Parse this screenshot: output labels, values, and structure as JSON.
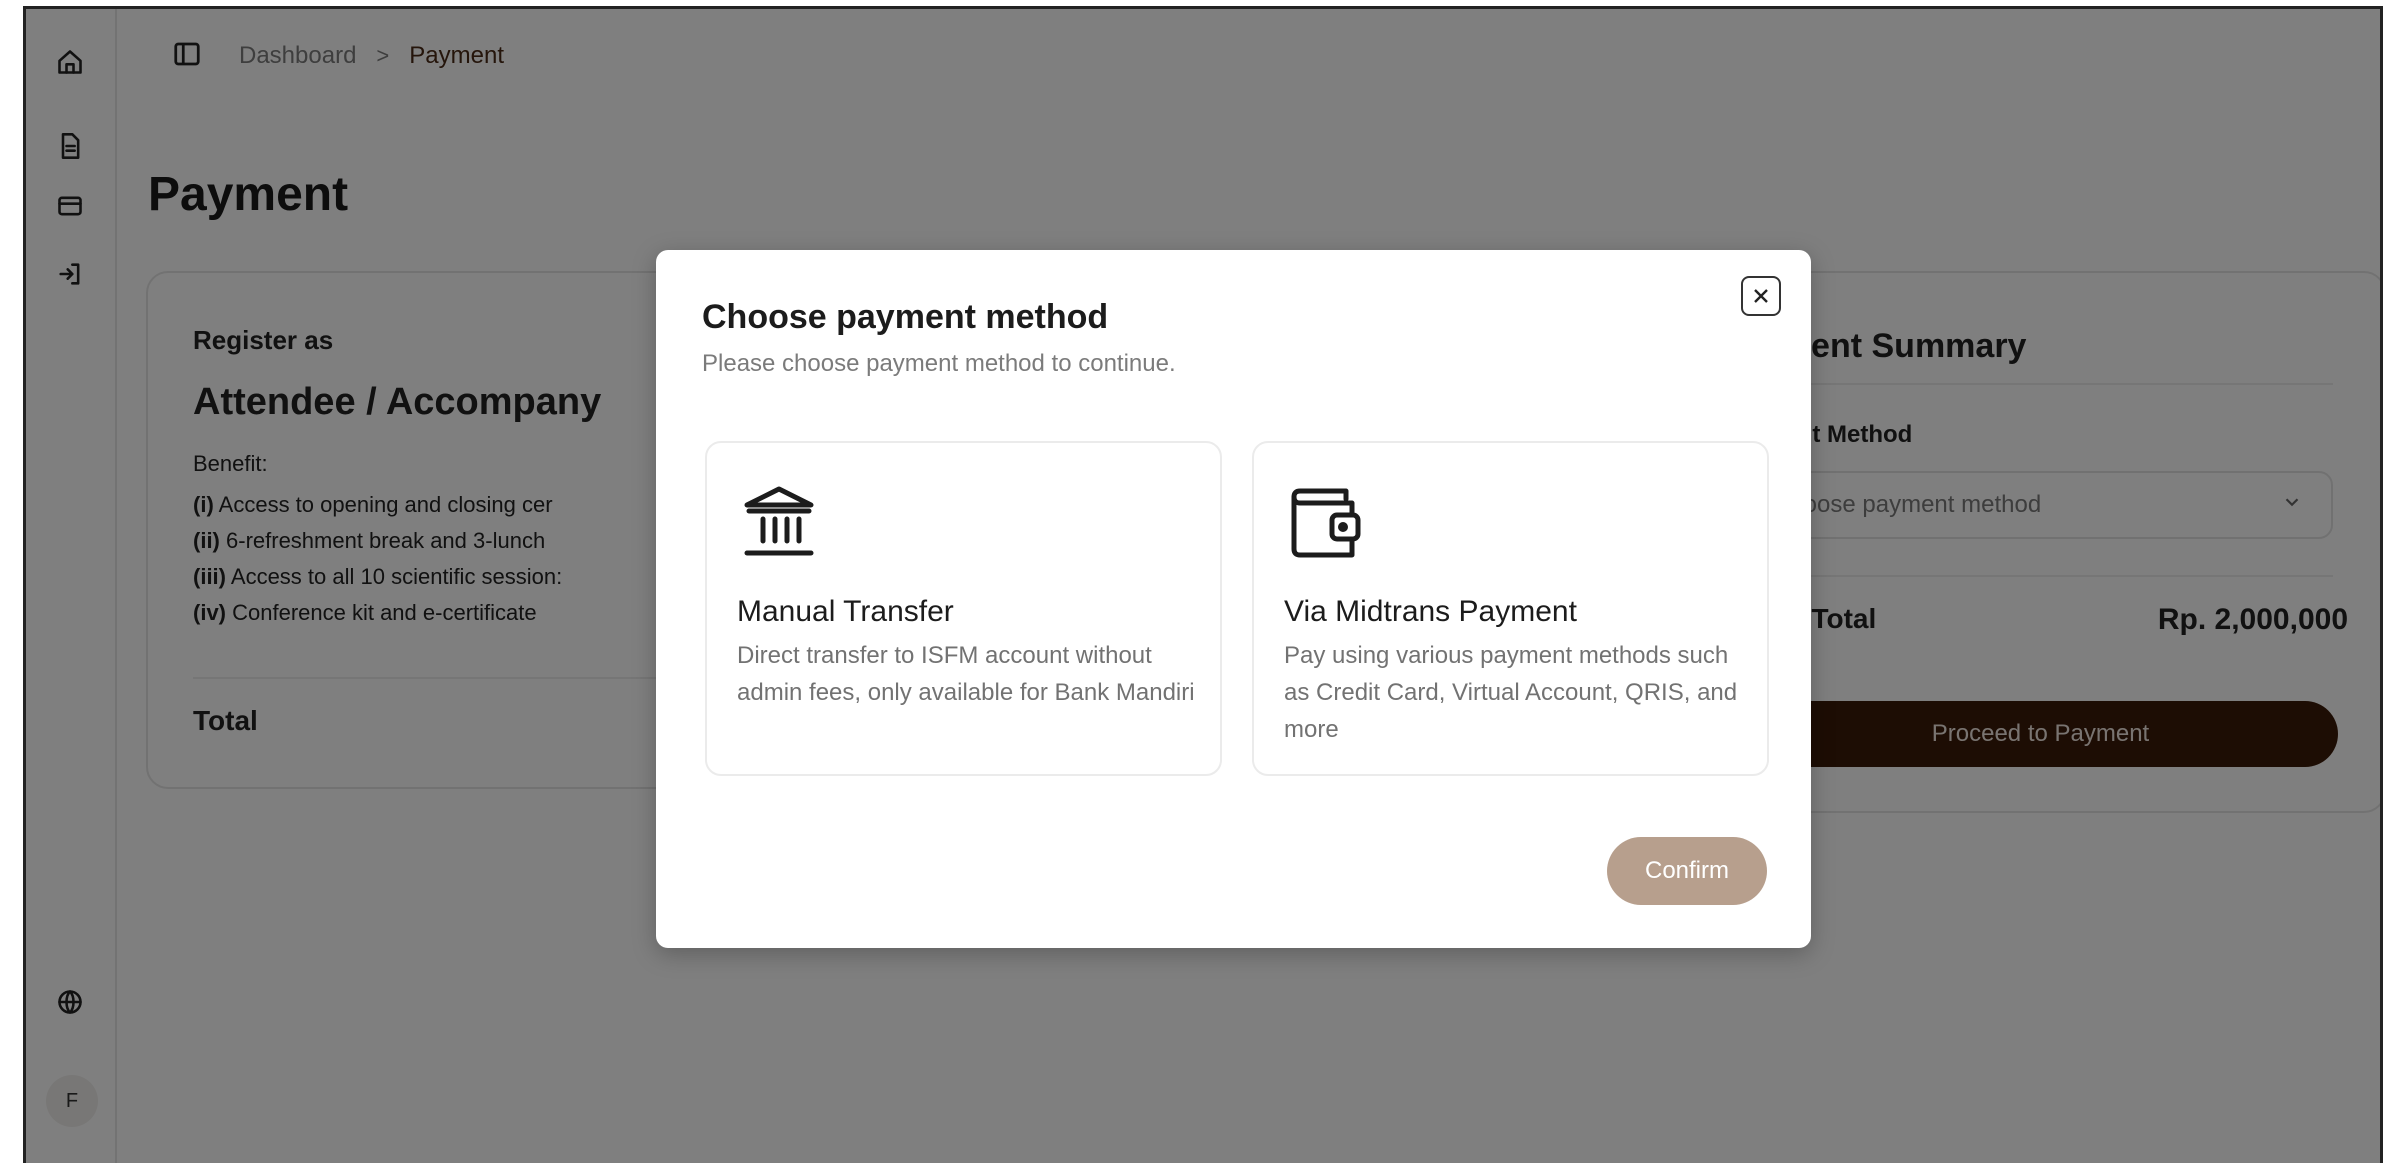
{
  "breadcrumb": {
    "items": [
      "Dashboard"
    ],
    "separator": ">",
    "current": "Payment"
  },
  "page": {
    "title": "Payment"
  },
  "sidebar": {
    "icons": [
      "home-icon",
      "document-icon",
      "credit-card-icon",
      "logout-icon",
      "globe-icon"
    ],
    "avatar_initial": "F"
  },
  "registration": {
    "label": "Register as",
    "type": "Attendee / Accompany",
    "benefit_label": "Benefit:",
    "benefits": [
      {
        "num": "(i)",
        "text": " Access to opening and closing cer"
      },
      {
        "num": "(ii)",
        "text": " 6-refreshment break and 3-lunch"
      },
      {
        "num": "(iii)",
        "text": " Access to all 10 scientific session:"
      },
      {
        "num": "(iv)",
        "text": " Conference kit and e-certificate"
      }
    ],
    "total_label": "Total"
  },
  "summary": {
    "title": "ayment Summary",
    "payment_method_label": "ıyment Method",
    "payment_method_placeholder": "Choose payment method",
    "grand_total_label": "rand Total",
    "grand_total_value": "Rp. 2,000,000",
    "proceed_label": "Proceed to Payment"
  },
  "modal": {
    "title": "Choose payment method",
    "subtitle": "Please choose payment method to continue.",
    "options": [
      {
        "icon": "bank-icon",
        "title": "Manual Transfer",
        "description": "Direct transfer to ISFM account without admin fees, only available for Bank Mandiri"
      },
      {
        "icon": "wallet-icon",
        "title": "Via Midtrans Payment",
        "description": "Pay using various payment methods such as Credit Card, Virtual Account, QRIS, and more"
      }
    ],
    "confirm_label": "Confirm"
  },
  "colors": {
    "brand_dark": "#3b1a08",
    "confirm_disabled": "#b79f8d",
    "breadcrumb_current": "#4a2a17"
  }
}
